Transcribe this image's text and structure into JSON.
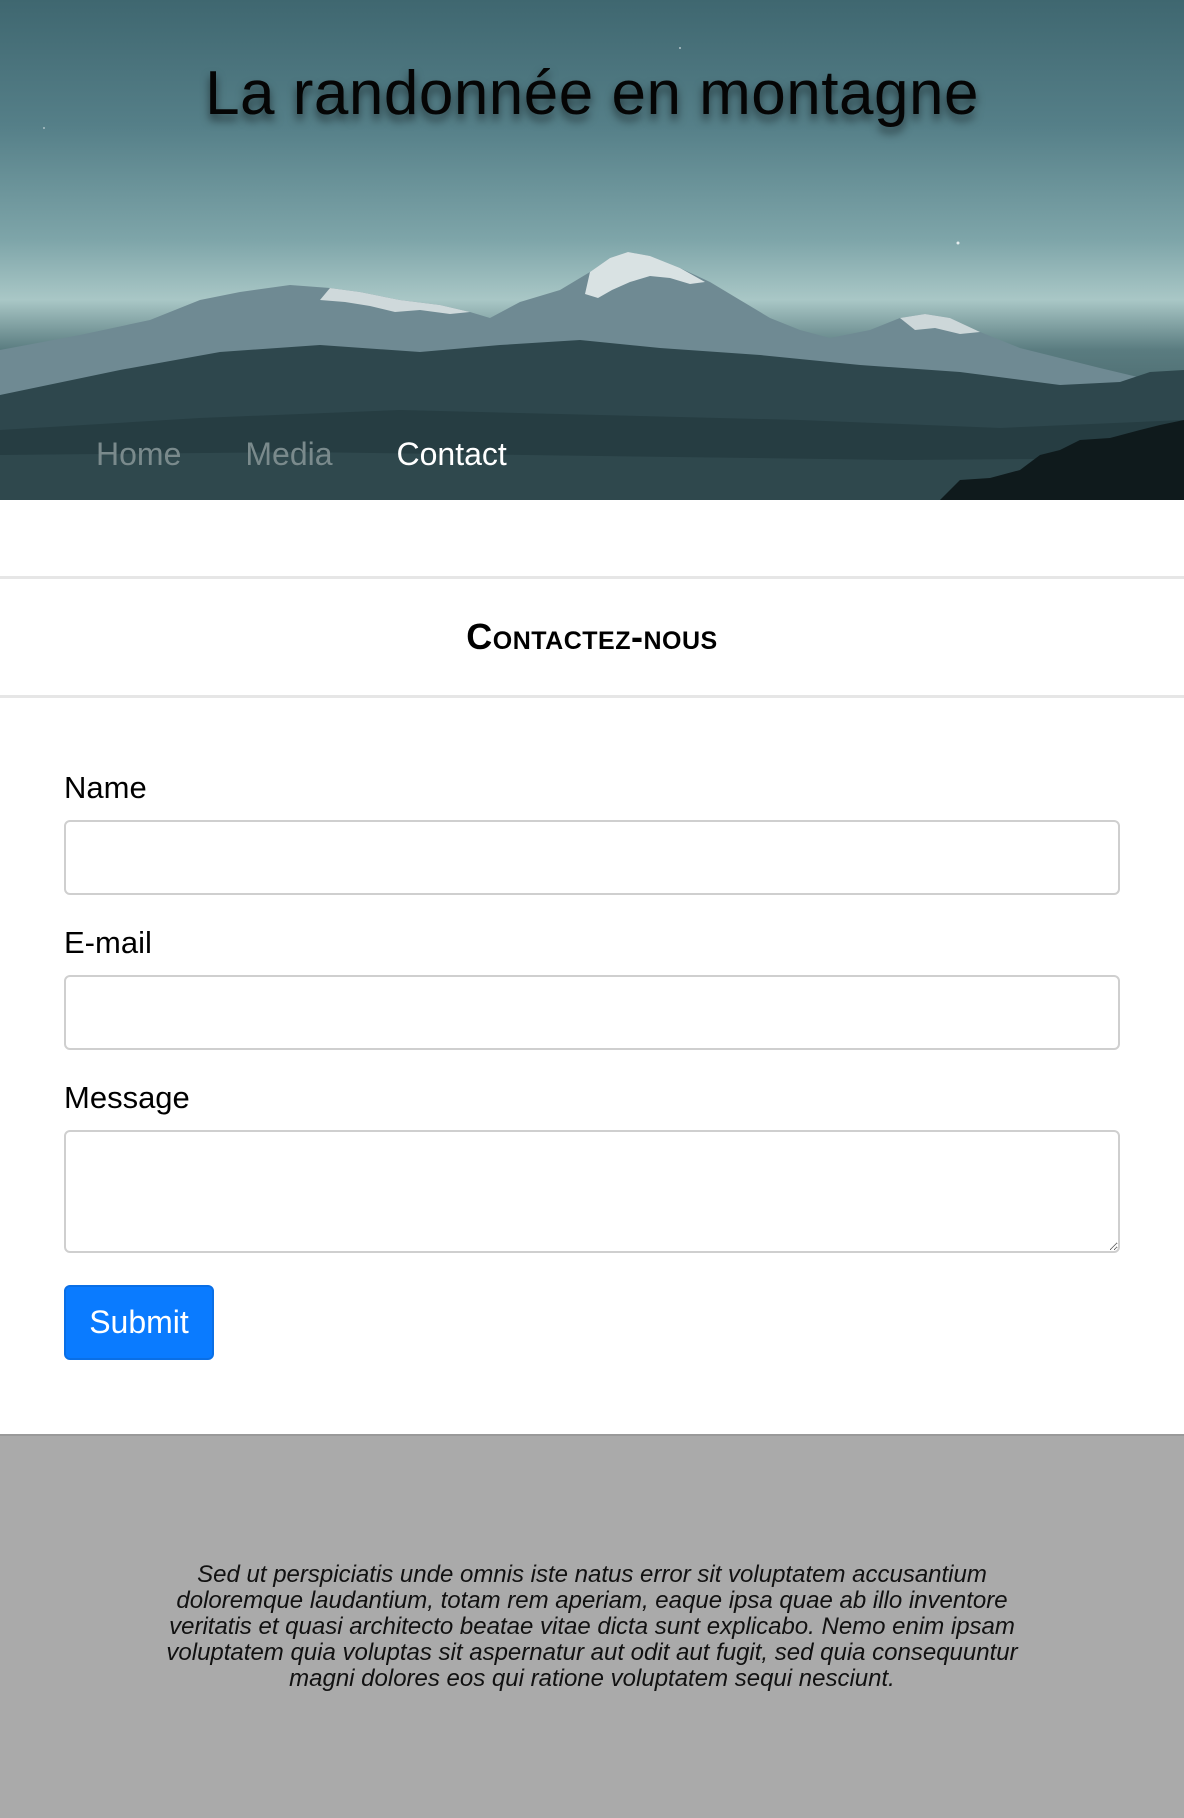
{
  "header": {
    "title": "La randonnée en montagne",
    "nav": [
      {
        "label": "Home",
        "active": false
      },
      {
        "label": "Media",
        "active": false
      },
      {
        "label": "Contact",
        "active": true
      }
    ]
  },
  "contact": {
    "heading": "Contactez-nous",
    "fields": {
      "name_label": "Name",
      "name_value": "",
      "email_label": "E-mail",
      "email_value": "",
      "message_label": "Message",
      "message_value": ""
    },
    "submit_label": "Submit"
  },
  "footer": {
    "text": "Sed ut perspiciatis unde omnis iste natus error sit voluptatem accusantium doloremque laudantium, totam rem aperiam, eaque ipsa quae ab illo inventore veritatis et quasi architecto beatae vitae dicta sunt explicabo. Nemo enim ipsam voluptatem quia voluptas sit aspernatur aut odit aut fugit, sed quia consequuntur magni dolores eos qui ratione voluptatem sequi nesciunt."
  },
  "colors": {
    "accent": "#0a7bff",
    "footer_bg": "#aaaaaa",
    "nav_active": "#ffffff",
    "nav_inactive": "#7a8a8c"
  }
}
